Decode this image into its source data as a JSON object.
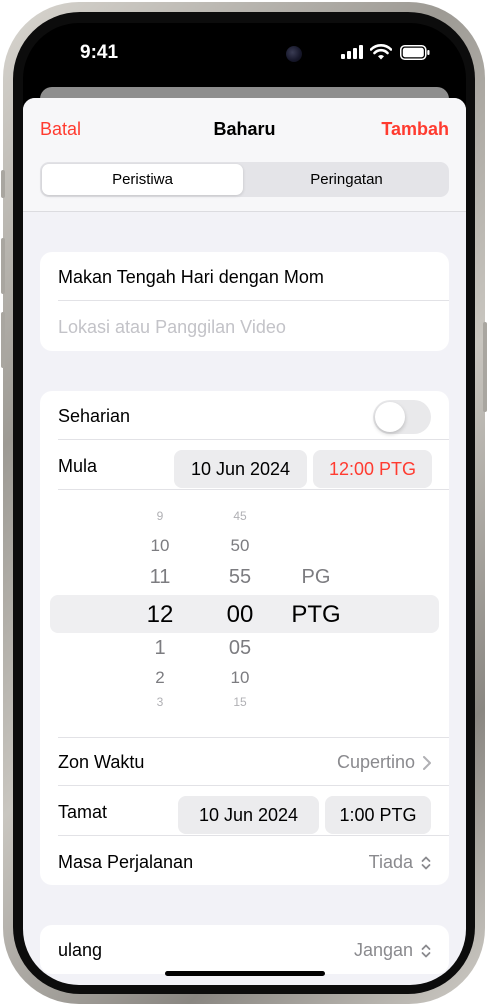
{
  "status": {
    "time": "9:41"
  },
  "nav": {
    "cancel": "Batal",
    "title": "Baharu",
    "add": "Tambah"
  },
  "segment": {
    "event": "Peristiwa",
    "reminder": "Peringatan"
  },
  "details": {
    "title_value": "Makan Tengah Hari dengan Mom",
    "location_placeholder": "Lokasi atau Panggilan Video"
  },
  "allday": {
    "label": "Seharian",
    "on": false
  },
  "start": {
    "label": "Mula",
    "date": "10 Jun 2024",
    "time": "12:00 PTG"
  },
  "picker": {
    "hours": [
      "9",
      "10",
      "11",
      "12",
      "1",
      "2",
      "3"
    ],
    "minutes": [
      "45",
      "50",
      "55",
      "00",
      "05",
      "10",
      "15"
    ],
    "periods": [
      "PG",
      "PTG"
    ],
    "selected": {
      "hour": "12",
      "minute": "00",
      "period": "PTG"
    }
  },
  "timezone": {
    "label": "Zon Waktu",
    "value": "Cupertino"
  },
  "end": {
    "label": "Tamat",
    "date": "10 Jun 2024",
    "time": "1:00 PTG"
  },
  "travel": {
    "label": "Masa Perjalanan",
    "value": "Tiada"
  },
  "repeat": {
    "label": "ulang",
    "value": "Jangan"
  },
  "colors": {
    "accent": "#ff3b30",
    "background": "#f2f2f7",
    "card": "#ffffff",
    "secondary_text": "#8a8a8e"
  }
}
